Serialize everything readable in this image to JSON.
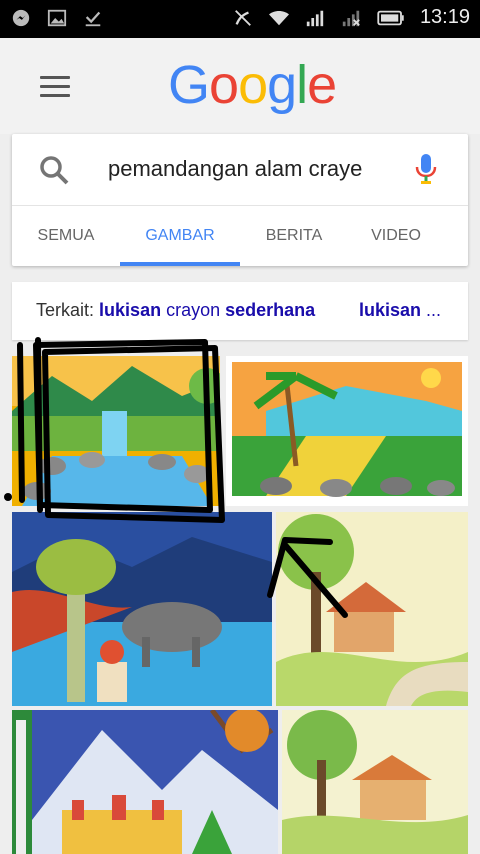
{
  "status_bar": {
    "time": "13:19",
    "left_icons": [
      "messenger-icon",
      "gallery-icon",
      "download-done-icon"
    ],
    "right_icons": [
      "nfc-muted-icon",
      "wifi-icon",
      "signal-icon",
      "signal-noservice-icon",
      "battery-icon"
    ]
  },
  "header": {
    "logo_text": [
      "G",
      "o",
      "o",
      "g",
      "l",
      "e"
    ],
    "logo_colors": [
      "#4285f4",
      "#ea4335",
      "#fbbc05",
      "#4285f4",
      "#34a853",
      "#ea4335"
    ]
  },
  "search": {
    "query": "pemandangan alam craye"
  },
  "tabs": [
    {
      "label": "SEMUA"
    },
    {
      "label": "GAMBAR"
    },
    {
      "label": "BERITA"
    },
    {
      "label": "VIDEO"
    }
  ],
  "related": {
    "prefix": "Terkait:",
    "chip1_bold1": "lukisan",
    "chip1_mid": " crayon ",
    "chip1_bold2": "sederhana",
    "chip2_bold": "lukisan",
    "chip2_rest": " ..."
  },
  "colors": {
    "accent": "#4285f4",
    "link": "#1a0dab"
  }
}
